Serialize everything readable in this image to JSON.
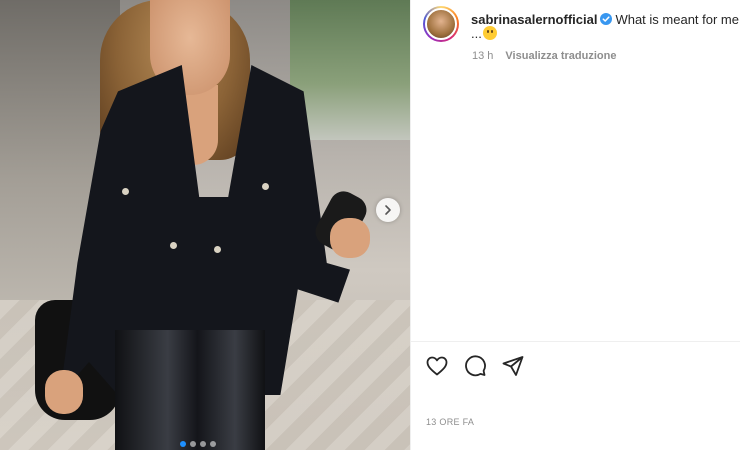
{
  "post": {
    "username": "sabrinasalernofficial",
    "caption": "What is meant for me w",
    "caption_cont": "...",
    "time": "13 h",
    "translate_label": "Visualizza traduzione",
    "time_ago": "13 ORE FA"
  },
  "media": {
    "carousel_total": 4,
    "carousel_active": 1
  },
  "actions": {
    "like_icon": "heart-icon",
    "comment_icon": "comment-icon",
    "share_icon": "share-icon"
  },
  "colors": {
    "verified": "#3897f0",
    "text": "#262626",
    "secondary": "#8e8e8e"
  }
}
